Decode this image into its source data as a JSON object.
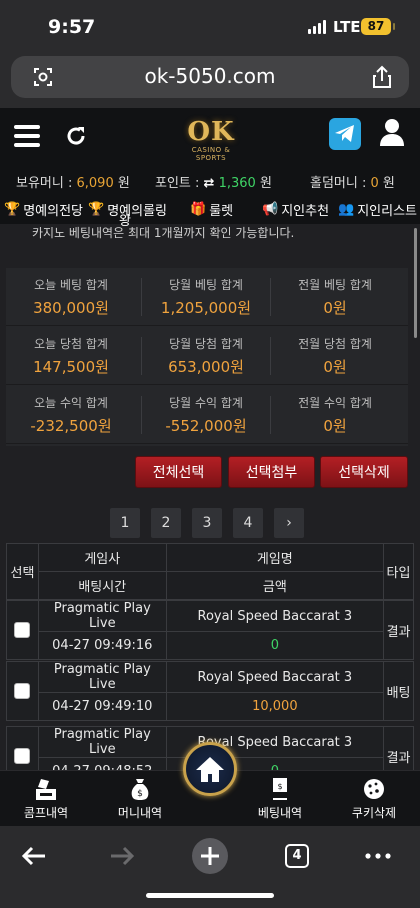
{
  "status_bar": {
    "time": "9:57",
    "network": "LTE",
    "battery": "87"
  },
  "browser": {
    "url": "ok-5050.com",
    "tab_count": "4"
  },
  "site": {
    "logo_text": "OK",
    "logo_sub": "CASINO & SPORTS"
  },
  "balances": {
    "money_label": "보유머니 :",
    "money_value": "6,090",
    "money_unit": "원",
    "point_label": "포인트 :",
    "point_value": "1,360",
    "point_unit": "원",
    "hold_label": "홀덤머니 :",
    "hold_value": "0",
    "hold_unit": "원"
  },
  "menu": [
    {
      "label": "명예의전당",
      "icon": "trophy-icon"
    },
    {
      "label": "명예의롤링",
      "label2": "왕",
      "icon": "trophy-icon"
    },
    {
      "label": "룰렛",
      "icon": "gift-icon"
    },
    {
      "label": "지인추천",
      "icon": "megaphone-icon"
    },
    {
      "label": "지인리스트",
      "icon": "users-icon"
    }
  ],
  "notice": "카지노 베팅내역은 최대 1개월까지 확인 가능합니다.",
  "stats": [
    [
      {
        "label": "오늘 베팅 합계",
        "value": "380,000원"
      },
      {
        "label": "당월 베팅 합계",
        "value": "1,205,000원"
      },
      {
        "label": "전월 베팅 합계",
        "value": "0원"
      }
    ],
    [
      {
        "label": "오늘 당첨 합계",
        "value": "147,500원"
      },
      {
        "label": "당월 당첨 합계",
        "value": "653,000원"
      },
      {
        "label": "전월 당첨 합계",
        "value": "0원"
      }
    ],
    [
      {
        "label": "오늘 수익 합계",
        "value": "-232,500원"
      },
      {
        "label": "당월 수익 합계",
        "value": "-552,000원"
      },
      {
        "label": "전월 수익 합계",
        "value": "0원"
      }
    ]
  ],
  "actions": {
    "select_all": "전체선택",
    "attach_selected": "선택첨부",
    "delete_selected": "선택삭제"
  },
  "pagination": {
    "pages": [
      "1",
      "2",
      "3",
      "4"
    ],
    "next": "›"
  },
  "table": {
    "headers": {
      "select": "선택",
      "provider": "게임사",
      "game": "게임명",
      "type": "타입",
      "bet_time": "배팅시간",
      "amount": "금액"
    },
    "rows": [
      {
        "provider": "Pragmatic Play Live",
        "game": "Royal Speed Baccarat 3",
        "time": "04-27 09:49:16",
        "amount": "0",
        "type": "결과",
        "amount_color": "green"
      },
      {
        "provider": "Pragmatic Play Live",
        "game": "Royal Speed Baccarat 3",
        "time": "04-27 09:49:10",
        "amount": "10,000",
        "type": "배팅",
        "amount_color": "orange"
      },
      {
        "provider": "Pragmatic Play Live",
        "game": "Royal Speed Baccarat 3",
        "time": "04-27 09:48:52",
        "amount": "0",
        "type": "결과",
        "amount_color": "green"
      }
    ]
  },
  "bottom_nav": {
    "coupon": "콤프내역",
    "money": "머니내역",
    "bet": "베팅내역",
    "cookie": "쿠키삭제"
  },
  "colors": {
    "accent_orange": "#f0a33e",
    "accent_green": "#3fd466",
    "button_red": "#b31f24",
    "gold": "#c9a24b"
  }
}
